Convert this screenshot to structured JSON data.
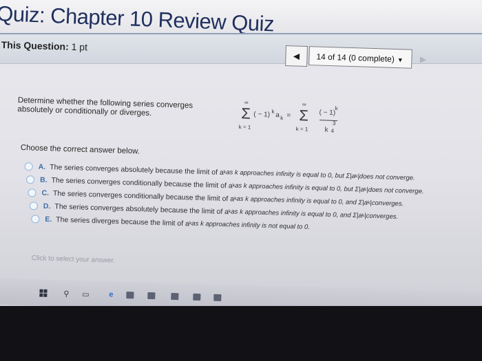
{
  "quiz": {
    "title": "Quiz: Chapter 10 Review Quiz",
    "this_question_label": "This Question:",
    "points": "1 pt"
  },
  "nav": {
    "status": "14 of 14 (0 complete)",
    "prev_icon": "arrow-left-icon",
    "next_icon": "arrow-right-icon"
  },
  "question": {
    "text": "Determine whether the following series converges absolutely or conditionally or diverges.",
    "formula": {
      "upper": "∞",
      "lower": "k = 1",
      "sigma": "Σ",
      "term": "( − 1)",
      "exp_k": "k",
      "a": "a",
      "sub_k": "k",
      "equals": "=",
      "numerator": "( − 1)",
      "denom": "k",
      "denom_exp_num": "3",
      "denom_exp_den": "4"
    },
    "prompt": "Choose the correct answer below."
  },
  "options": [
    {
      "letter": "A.",
      "text": "The series converges absolutely because the limit of a",
      "sub": "k",
      "mid": " as k approaches infinity is equal to 0, but Σ",
      "abs": "|a",
      "abs_sub": "k",
      "abs_end": "|",
      "tail": " does not converge."
    },
    {
      "letter": "B.",
      "text": "The series converges conditionally because the limit of a",
      "sub": "k",
      "mid": " as k approaches infinity is equal to 0, but Σ",
      "abs": "|a",
      "abs_sub": "k",
      "abs_end": "|",
      "tail": " does not converge."
    },
    {
      "letter": "C.",
      "text": "The series converges conditionally because the limit of a",
      "sub": "k",
      "mid": " as k approaches infinity is equal to 0, and Σ",
      "abs": "|a",
      "abs_sub": "k",
      "abs_end": "|",
      "tail": " converges."
    },
    {
      "letter": "D.",
      "text": "The series converges absolutely because the limit of a",
      "sub": "k",
      "mid": " as k approaches infinity is equal to 0, and Σ",
      "abs": "|a",
      "abs_sub": "k",
      "abs_end": "|",
      "tail": " converges."
    },
    {
      "letter": "E.",
      "text": "The series diverges because the limit of a",
      "sub": "k",
      "mid": " as k approaches infinity is not equal to 0.",
      "abs": "",
      "abs_sub": "",
      "abs_end": "",
      "tail": ""
    }
  ],
  "footer": {
    "click_to_select": "Click to select your answer."
  },
  "taskbar": {
    "icons": [
      "windows-icon",
      "search-icon",
      "task-view-icon",
      "edge-icon",
      "app-icon",
      "store-icon",
      "app-icon",
      "app-icon",
      "app-icon"
    ]
  },
  "colors": {
    "title": "#1f2f5e",
    "option_letter": "#3f6ea8",
    "radio_border": "#8fb6dd"
  }
}
